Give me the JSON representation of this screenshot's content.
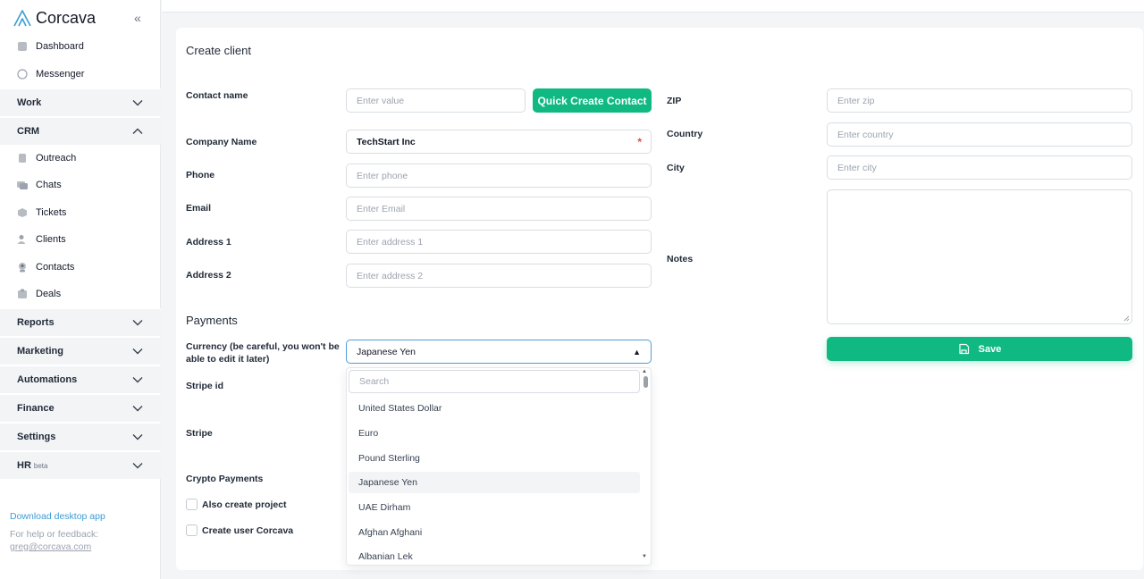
{
  "app": {
    "brand_name": "Corcava",
    "accent_color": "#10b981",
    "link_color": "#3b9bd6"
  },
  "sidebar": {
    "top_items": [
      {
        "label": "Dashboard",
        "icon": "dashboard-icon"
      },
      {
        "label": "Messenger",
        "icon": "messenger-icon"
      }
    ],
    "sections": {
      "work": "Work",
      "crm": "CRM",
      "reports": "Reports",
      "marketing": "Marketing",
      "automations": "Automations",
      "finance": "Finance",
      "settings": "Settings",
      "hr": "HR",
      "hr_badge": "beta"
    },
    "crm_items": [
      {
        "label": "Outreach",
        "icon": "outreach-icon"
      },
      {
        "label": "Chats",
        "icon": "chats-icon"
      },
      {
        "label": "Tickets",
        "icon": "tickets-icon"
      },
      {
        "label": "Clients",
        "icon": "clients-icon"
      },
      {
        "label": "Contacts",
        "icon": "contacts-icon"
      },
      {
        "label": "Deals",
        "icon": "deals-icon"
      }
    ],
    "download_link": "Download desktop app",
    "help_text": "For help or feedback:",
    "help_email": "greg@corcava.com"
  },
  "form": {
    "title": "Create client",
    "contact_name": {
      "label": "Contact name",
      "placeholder": "Enter value"
    },
    "quick_create_button": "Quick Create Contact",
    "company_name": {
      "label": "Company Name",
      "value": "TechStart Inc",
      "required_mark": "*"
    },
    "phone": {
      "label": "Phone",
      "placeholder": "Enter phone"
    },
    "email": {
      "label": "Email",
      "placeholder": "Enter Email"
    },
    "address1": {
      "label": "Address 1",
      "placeholder": "Enter address 1"
    },
    "address2": {
      "label": "Address 2",
      "placeholder": "Enter address 2"
    },
    "zip": {
      "label": "ZIP",
      "placeholder": "Enter zip"
    },
    "country": {
      "label": "Country",
      "placeholder": "Enter country"
    },
    "city": {
      "label": "City",
      "placeholder": "Enter city"
    },
    "notes": {
      "label": "Notes"
    },
    "save_button": "Save",
    "payments_title": "Payments",
    "currency": {
      "label_line1": "Currency (be careful, you won't be",
      "label_line2": "able to edit it later)",
      "selected": "Japanese Yen",
      "search_placeholder": "Search",
      "options": [
        "United States Dollar",
        "Euro",
        "Pound Sterling",
        "Japanese Yen",
        "UAE Dirham",
        "Afghan Afghani",
        "Albanian Lek"
      ]
    },
    "stripe_id_label": "Stripe id",
    "stripe_label": "Stripe",
    "crypto_label": "Crypto Payments",
    "also_create_project": "Also create project",
    "create_user": "Create user Corcava"
  }
}
